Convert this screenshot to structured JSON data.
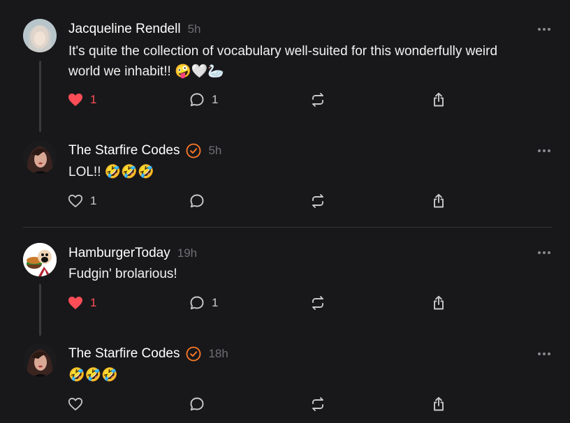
{
  "posts": [
    {
      "author": "Jacqueline Rendell",
      "time": "5h",
      "verified": false,
      "text_line1": "It's quite the collection of vocabulary well-suited for this wonderfully weird",
      "text_line2": "world we inhabit!! 🤪🤍🦢",
      "liked": true,
      "likes": "1",
      "replies": "1"
    },
    {
      "author": "The Starfire Codes",
      "time": "5h",
      "verified": true,
      "text_line1": "LOL!! 🤣🤣🤣",
      "liked": false,
      "likes": "1",
      "replies": ""
    },
    {
      "author": "HamburgerToday",
      "time": "19h",
      "verified": false,
      "text_line1": "Fudgin' brolarious!",
      "liked": true,
      "likes": "1",
      "replies": "1"
    },
    {
      "author": "The Starfire Codes",
      "time": "18h",
      "verified": true,
      "text_line1": "🤣🤣🤣",
      "liked": false,
      "likes": "",
      "replies": ""
    }
  ],
  "colors": {
    "background": "#18181a",
    "like_active": "#ff4d57",
    "verified_badge": "#ff7a29",
    "muted_text": "#6f6f74"
  },
  "icons": [
    "heart-icon",
    "comment-icon",
    "repost-icon",
    "share-icon",
    "more-icon",
    "verified-badge-icon"
  ]
}
